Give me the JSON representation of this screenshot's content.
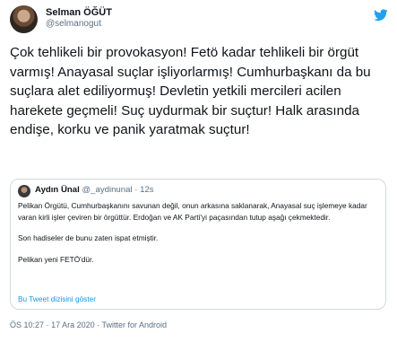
{
  "author": {
    "display_name": "Selman ÖĞÜT",
    "handle": "@selmanogut"
  },
  "tweet": {
    "text": "Çok tehlikeli bir provokasyon! Fetö kadar tehlikeli bir örgüt varmış! Anayasal suçlar işliyorlarmış! Cumhurbaşkanı da bu suçlara alet ediliyormuş! Devletin yetkili mercileri acilen harekete geçmeli! Suç uydurmak bir suçtur! Halk arasında endişe, korku ve panik yaratmak suçtur!"
  },
  "quote": {
    "name": "Aydın Ünal",
    "handle": "@_aydinunal",
    "separator": "·",
    "time": "12s",
    "paragraph1": "Pelikan Örgütü, Cumhurbaşkanını savunan değil, onun arkasına saklanarak, Anayasal suç işlemeye kadar varan kirli işler çeviren bir örgüttür. Erdoğan ve AK Parti'yi paçasından tutup aşağı çekmektedir.",
    "paragraph2": "Son hadiseler de bunu zaten ispat etmiştir.",
    "paragraph3": "Pelikan yeni FETÖ'dür.",
    "show_thread": "Bu Tweet dizisini göster"
  },
  "footer": {
    "time": "ÖS 10:27",
    "date": "17 Ara 2020",
    "source": "Twitter for Android",
    "separator": "·"
  },
  "icons": {
    "twitter": "twitter-bird-icon"
  },
  "colors": {
    "twitter_blue": "#1da1f2",
    "link": "#1b95e0",
    "text": "#0f1419",
    "muted": "#5b7083",
    "border": "#cfd9de"
  }
}
